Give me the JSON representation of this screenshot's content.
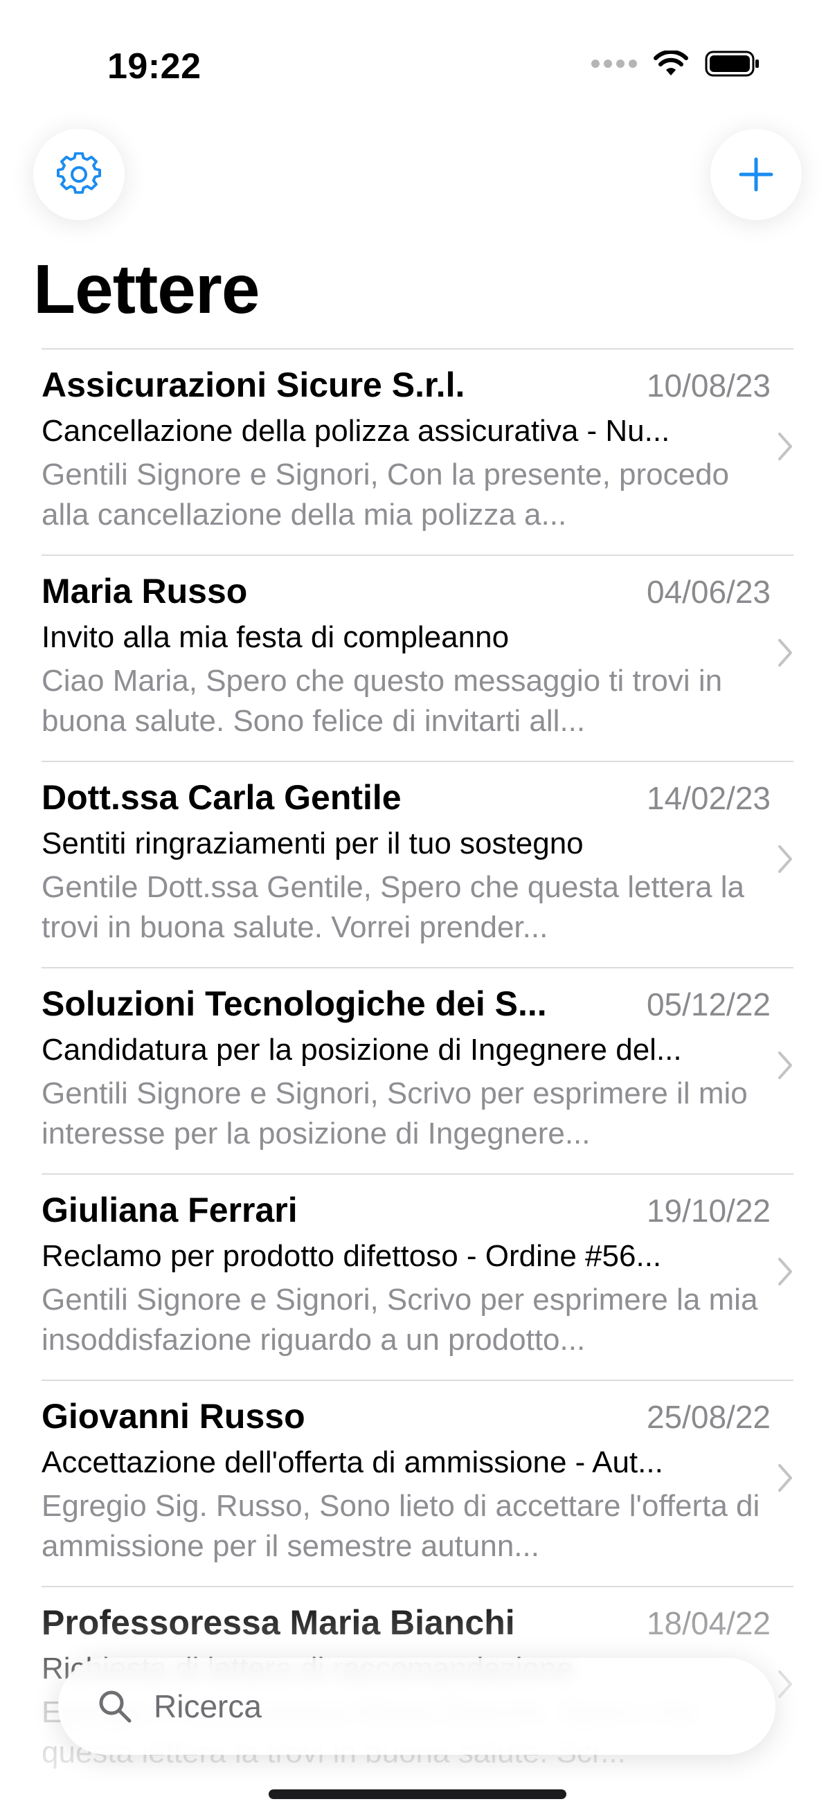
{
  "status_bar": {
    "time": "19:22"
  },
  "header": {
    "title": "Lettere"
  },
  "accent_color": "#1a8cf0",
  "letters": [
    {
      "sender": "Assicurazioni Sicure S.r.l.",
      "date": "10/08/23",
      "subject": "Cancellazione della polizza assicurativa - Nu...",
      "preview": "Gentili Signore e Signori,  Con la presente, procedo alla cancellazione della mia polizza a..."
    },
    {
      "sender": "Maria Russo",
      "date": "04/06/23",
      "subject": "Invito alla mia festa di compleanno",
      "preview": "Ciao Maria,  Spero che questo messaggio ti trovi in buona salute. Sono felice di invitarti all..."
    },
    {
      "sender": "Dott.ssa Carla Gentile",
      "date": "14/02/23",
      "subject": "Sentiti ringraziamenti per il tuo sostegno",
      "preview": "Gentile Dott.ssa Gentile,  Spero che questa lettera la trovi in buona salute. Vorrei prender..."
    },
    {
      "sender": "Soluzioni Tecnologiche dei S...",
      "date": "05/12/22",
      "subject": "Candidatura per la posizione di Ingegnere del...",
      "preview": "Gentili Signore e Signori,  Scrivo per esprimere il mio interesse per la posizione di Ingegnere..."
    },
    {
      "sender": "Giuliana Ferrari",
      "date": "19/10/22",
      "subject": "Reclamo per prodotto difettoso - Ordine #56...",
      "preview": "Gentili Signore e Signori,  Scrivo per esprimere la mia insoddisfazione riguardo a un prodotto..."
    },
    {
      "sender": "Giovanni Russo",
      "date": "25/08/22",
      "subject": "Accettazione dell'offerta di ammissione - Aut...",
      "preview": "Egregio Sig. Russo,  Sono lieto di accettare l'offerta di ammissione per il semestre autunn..."
    },
    {
      "sender": "Professoressa Maria Bianchi",
      "date": "18/04/22",
      "subject": "Richiesta di lettera di raccomandazione",
      "preview": "Egregia Professoressa Maria Bianchi,  Spero che questa lettera la trovi in buona salute. Scr..."
    }
  ],
  "search": {
    "placeholder": "Ricerca"
  }
}
